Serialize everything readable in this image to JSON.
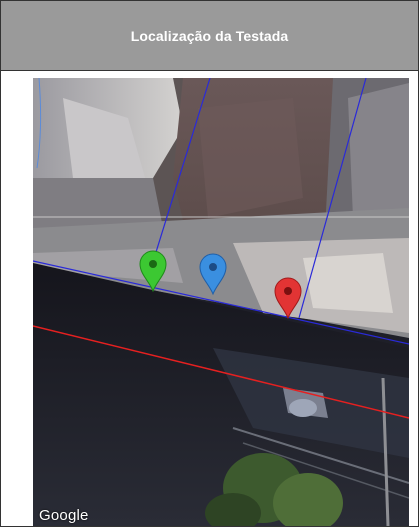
{
  "header": {
    "title": "Localização da Testada"
  },
  "map": {
    "attribution": "Google",
    "markers": [
      {
        "name": "green-marker",
        "color": "#3cc832"
      },
      {
        "name": "blue-marker",
        "color": "#3a8fe0"
      },
      {
        "name": "red-marker",
        "color": "#e23434"
      }
    ],
    "colors": {
      "boundary_line": "#2a2ad8",
      "front_line": "#e52020",
      "reference_line": "#c8c8c8"
    }
  }
}
